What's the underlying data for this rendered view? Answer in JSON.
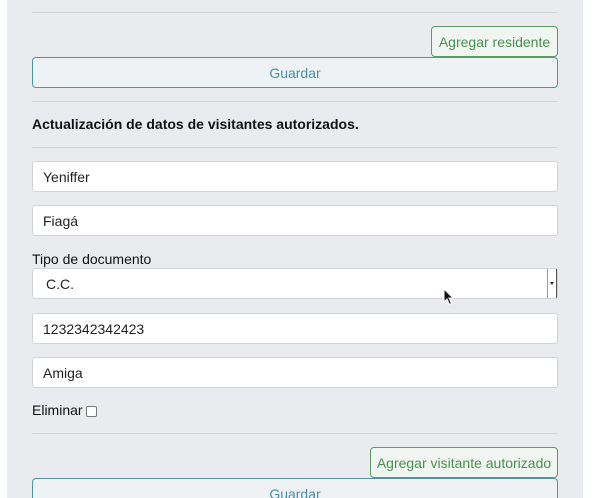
{
  "residents": {
    "add_button_label": "Agregar residente",
    "save_button_label": "Guardar"
  },
  "visitors": {
    "heading": "Actualización de datos de visitantes autorizados.",
    "first_name_value": "Yeniffer",
    "last_name_value": "Fiagá",
    "doc_type_label": "Tipo de documento",
    "doc_type_selected": "C.C.",
    "doc_number_value": "1232342342423",
    "relationship_value": "Amiga",
    "delete_label": "Eliminar",
    "add_button_label": "Agregar visitante autorizado",
    "save_button_label": "Guardar"
  },
  "colors": {
    "panel_bg": "#e9ebee",
    "success_outline": "#5d9b62",
    "info_outline": "#4f94a1"
  }
}
